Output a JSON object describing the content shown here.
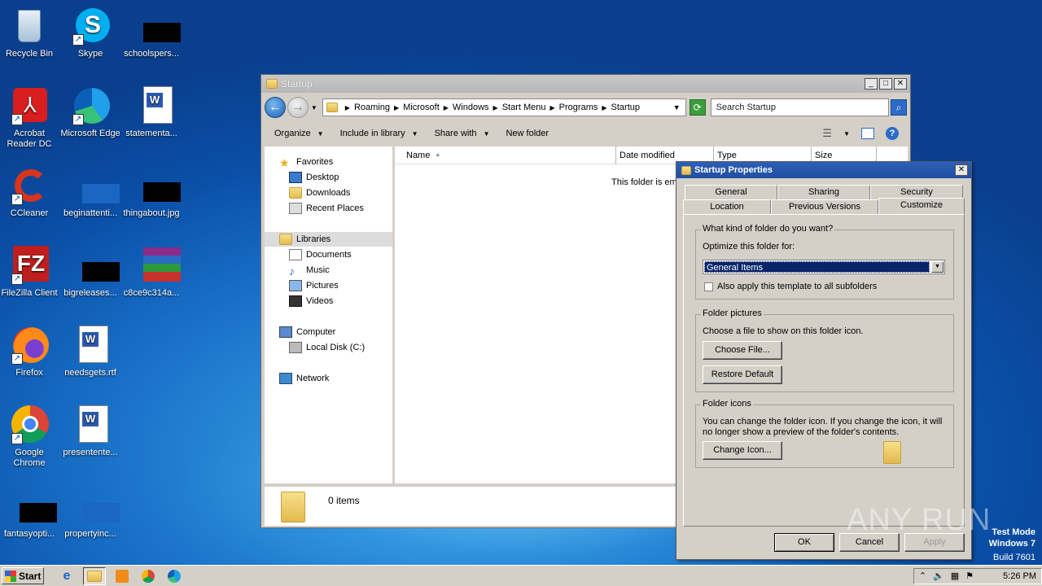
{
  "desktop": {
    "icons": [
      {
        "label": "Recycle Bin"
      },
      {
        "label": "Skype"
      },
      {
        "label": "schoolspers..."
      },
      {
        "label": "Acrobat Reader DC"
      },
      {
        "label": "Microsoft Edge"
      },
      {
        "label": "statementa..."
      },
      {
        "label": "CCleaner"
      },
      {
        "label": "beginattenti..."
      },
      {
        "label": "thingabout.jpg"
      },
      {
        "label": "FileZilla Client"
      },
      {
        "label": "bigreleases..."
      },
      {
        "label": "c8ce9c314a..."
      },
      {
        "label": "Firefox"
      },
      {
        "label": "needsgets.rtf"
      },
      {
        "label": "Google Chrome"
      },
      {
        "label": "presentente..."
      },
      {
        "label": "fantasyopti..."
      },
      {
        "label": "propertyinc..."
      }
    ]
  },
  "explorer": {
    "title": "Startup",
    "breadcrumb": [
      "Roaming",
      "Microsoft",
      "Windows",
      "Start Menu",
      "Programs",
      "Startup"
    ],
    "search_placeholder": "Search Startup",
    "commands": [
      "Organize",
      "Include in library",
      "Share with",
      "New folder"
    ],
    "nav": {
      "favorites": "Favorites",
      "desktop": "Desktop",
      "downloads": "Downloads",
      "recent": "Recent Places",
      "libraries": "Libraries",
      "documents": "Documents",
      "music": "Music",
      "pictures": "Pictures",
      "videos": "Videos",
      "computer": "Computer",
      "local_disk": "Local Disk (C:)",
      "network": "Network"
    },
    "columns": [
      "Name",
      "Date modified",
      "Type",
      "Size"
    ],
    "empty_message": "This folder is emp",
    "item_count": "0 items"
  },
  "props": {
    "title": "Startup Properties",
    "tabs_row1": [
      "General",
      "Sharing",
      "Security"
    ],
    "tabs_row2": [
      "Location",
      "Previous Versions",
      "Customize"
    ],
    "group1_title": "What kind of folder do you want?",
    "optimize_label": "Optimize this folder for:",
    "optimize_value": "General Items",
    "apply_all_label": "Also apply this template to all subfolders",
    "group2_title": "Folder pictures",
    "choose_file_text": "Choose a file to show on this folder icon.",
    "choose_file_btn": "Choose File...",
    "restore_btn": "Restore Default",
    "group3_title": "Folder icons",
    "icons_text_1": "You can change the folder icon. If you change the icon, it will",
    "icons_text_2": "no longer show a preview of the folder's contents.",
    "change_icon_btn": "Change Icon...",
    "ok": "OK",
    "cancel": "Cancel",
    "apply": "Apply"
  },
  "watermark": "ANY RUN",
  "system": {
    "test_mode": "Test Mode",
    "os": "Windows 7",
    "build": "Build 7601"
  },
  "taskbar": {
    "start": "Start",
    "clock": "5:26 PM"
  }
}
